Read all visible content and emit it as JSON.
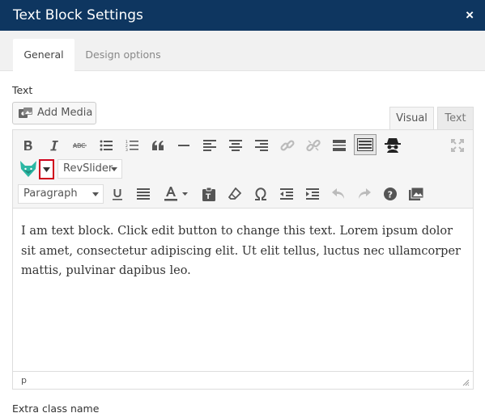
{
  "window": {
    "title": "Text Block Settings",
    "close_glyph": "×"
  },
  "tabs": [
    {
      "label": "General",
      "active": true
    },
    {
      "label": "Design options",
      "active": false
    }
  ],
  "text_field": {
    "label": "Text"
  },
  "add_media": {
    "label": "Add Media"
  },
  "editor_modes": {
    "visual": "Visual",
    "text": "Text",
    "selected": "Visual"
  },
  "toolbar": {
    "row1": [
      "bold-icon",
      "italic-icon",
      "strikethrough-icon",
      "bullet-list-icon",
      "numbered-list-icon",
      "blockquote-icon",
      "horizontal-rule-icon",
      "align-left-icon",
      "align-center-icon",
      "align-right-icon",
      "link-icon",
      "unlink-icon",
      "read-more-icon",
      "toolbar-toggle-icon",
      "spy-icon",
      "fullscreen-icon"
    ],
    "revslider_label": "RevSlider",
    "format_select": "Paragraph",
    "row3": [
      "underline-icon",
      "justify-icon",
      "text-color-icon",
      "paste-text-icon",
      "clear-formatting-icon",
      "special-character-icon",
      "outdent-icon",
      "indent-icon",
      "undo-icon",
      "redo-icon",
      "help-icon",
      "media-icon"
    ]
  },
  "editor": {
    "content": "I am text block. Click edit button to change this text. Lorem ipsum dolor sit amet, consectetur adipiscing elit. Ut elit tellus, luctus nec ullamcorper mattis, pulvinar dapibus leo.",
    "path": "p"
  },
  "extra_class": {
    "label": "Extra class name"
  },
  "colors": {
    "titlebar": "#0e3660",
    "tab_bar": "#f1f1f1",
    "toolbar": "#f5f5f5",
    "dropdown_highlight": "#d0021b",
    "fox_icon": "#2bb7a3"
  }
}
